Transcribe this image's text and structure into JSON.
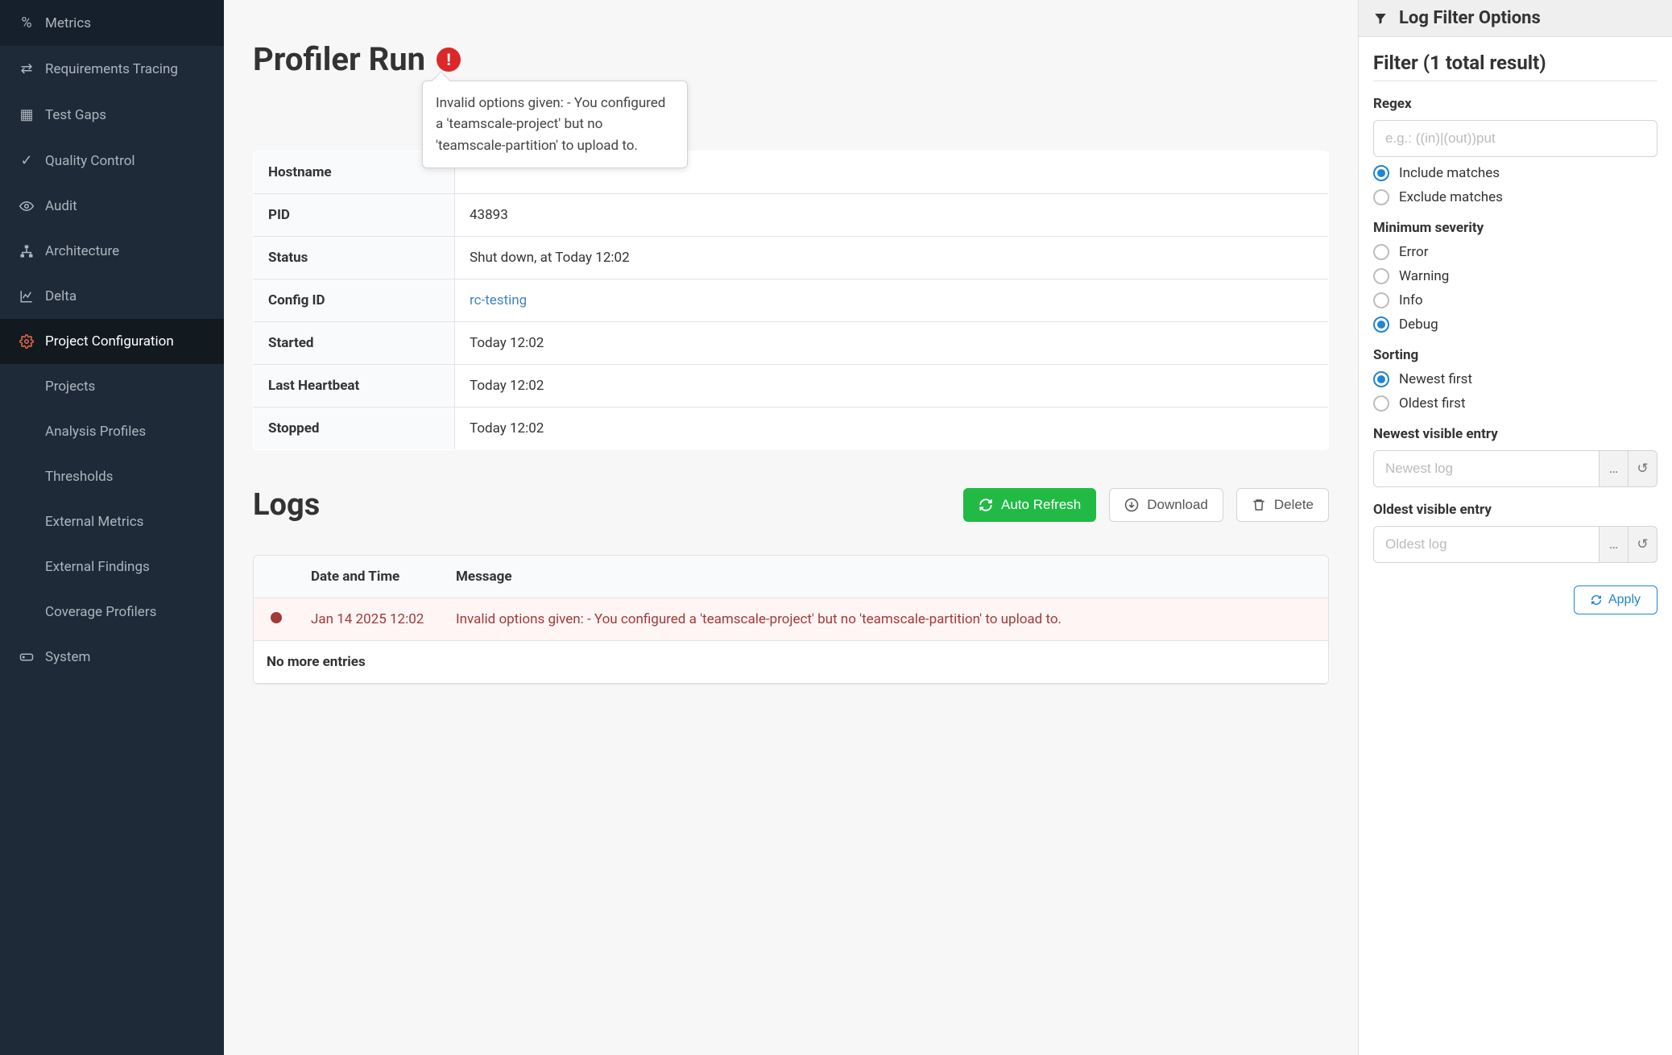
{
  "sidebar": {
    "items": [
      {
        "label": "Metrics",
        "icon": "percent-icon"
      },
      {
        "label": "Requirements Tracing",
        "icon": "exchange-icon"
      },
      {
        "label": "Test Gaps",
        "icon": "grid-icon"
      },
      {
        "label": "Quality Control",
        "icon": "check-circle-icon"
      },
      {
        "label": "Audit",
        "icon": "eye-icon"
      },
      {
        "label": "Architecture",
        "icon": "sitemap-icon"
      },
      {
        "label": "Delta",
        "icon": "chart-line-icon"
      },
      {
        "label": "Project Configuration",
        "icon": "gear-icon",
        "active": true
      },
      {
        "label": "System",
        "icon": "drive-icon"
      }
    ],
    "sub_items": [
      "Projects",
      "Analysis Profiles",
      "Thresholds",
      "External Metrics",
      "External Findings",
      "Coverage Profilers"
    ]
  },
  "page": {
    "title": "Profiler Run",
    "tooltip": "Invalid options given: - You configured a 'teamscale-project' but no 'teamscale-partition' to upload to."
  },
  "info": [
    {
      "key": "Hostname",
      "value": ""
    },
    {
      "key": "PID",
      "value": "43893"
    },
    {
      "key": "Status",
      "value": "Shut down, at Today 12:02"
    },
    {
      "key": "Config ID",
      "value": "rc-testing",
      "link": true
    },
    {
      "key": "Started",
      "value": "Today 12:02"
    },
    {
      "key": "Last Heartbeat",
      "value": "Today 12:02"
    },
    {
      "key": "Stopped",
      "value": "Today 12:02"
    }
  ],
  "logs": {
    "heading": "Logs",
    "buttons": {
      "auto_refresh": "Auto Refresh",
      "download": "Download",
      "delete": "Delete"
    },
    "columns": {
      "col0": "",
      "col1": "Date and Time",
      "col2": "Message"
    },
    "rows": [
      {
        "date": "Jan 14 2025 12:02",
        "message": "Invalid options given: - You configured a 'teamscale-project' but no 'teamscale-partition' to upload to."
      }
    ],
    "no_more": "No more entries"
  },
  "filter": {
    "header": "Log Filter Options",
    "title": "Filter (1 total result)",
    "regex_label": "Regex",
    "regex_placeholder": "e.g.: ((in)|(out))put",
    "match_options": {
      "include": "Include matches",
      "exclude": "Exclude matches"
    },
    "severity_label": "Minimum severity",
    "severity_options": [
      "Error",
      "Warning",
      "Info",
      "Debug"
    ],
    "severity_selected": "Debug",
    "sorting_label": "Sorting",
    "sorting_options": {
      "newest": "Newest first",
      "oldest": "Oldest first"
    },
    "newest_label": "Newest visible entry",
    "newest_placeholder": "Newest log",
    "oldest_label": "Oldest visible entry",
    "oldest_placeholder": "Oldest log",
    "apply": "Apply"
  }
}
